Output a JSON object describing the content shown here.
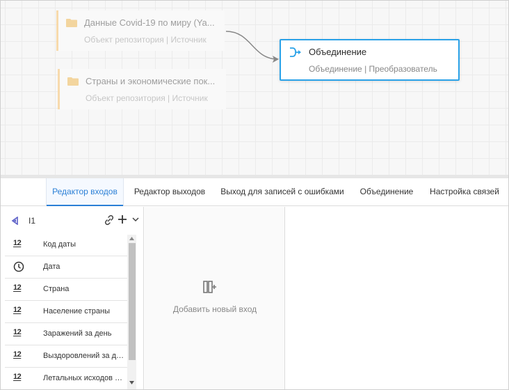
{
  "canvas": {
    "nodes": [
      {
        "title": "Данные Covid-19 по миру (Ya...",
        "subtitle": "Объект репозитория | Источник"
      },
      {
        "title": "Страны и экономические пок...",
        "subtitle": "Объект репозитория | Источник"
      }
    ],
    "join_node": {
      "title": "Объединение",
      "subtitle": "Объединение | Преобразователь"
    },
    "accent_color": "#2aa2e8",
    "source_accent_color": "#f8d9a8"
  },
  "tabs": [
    {
      "label": "Редактор входов",
      "active": true
    },
    {
      "label": "Редактор выходов",
      "active": false
    },
    {
      "label": "Выход для записей с ошибками",
      "active": false
    },
    {
      "label": "Объединение",
      "active": false
    },
    {
      "label": "Настройка связей",
      "active": false
    }
  ],
  "input_panel": {
    "input_name": "I1",
    "fields": [
      {
        "type_icon": "12",
        "icon_name": "number-type-icon",
        "name": "Код даты"
      },
      {
        "type_icon": "clock",
        "icon_name": "datetime-type-icon",
        "name": "Дата"
      },
      {
        "type_icon": "12",
        "icon_name": "number-type-icon",
        "name": "Страна"
      },
      {
        "type_icon": "12",
        "icon_name": "number-type-icon",
        "name": "Население страны"
      },
      {
        "type_icon": "12",
        "icon_name": "number-type-icon",
        "name": "Заражений за день"
      },
      {
        "type_icon": "12",
        "icon_name": "number-type-icon",
        "name": "Выздоровлений за день"
      },
      {
        "type_icon": "12",
        "icon_name": "number-type-icon",
        "name": "Летальных исходов за ..."
      }
    ]
  },
  "middle_panel": {
    "add_input_label": "Добавить новый вход"
  }
}
